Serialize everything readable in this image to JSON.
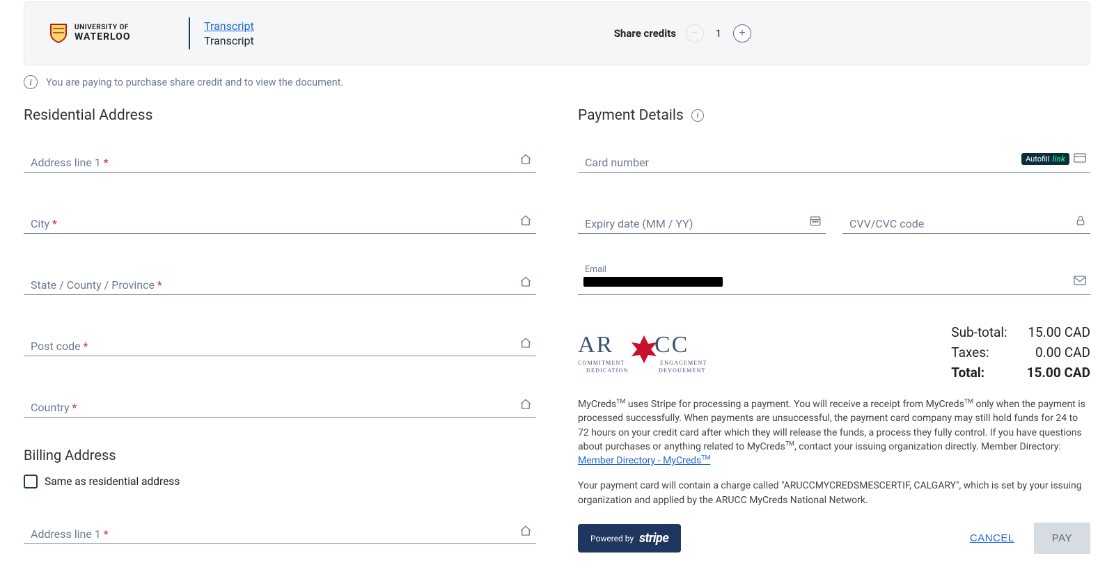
{
  "header": {
    "org": {
      "line1": "UNIVERSITY OF",
      "line2": "WATERLOO"
    },
    "doc_link": "Transcript",
    "doc_subtitle": "Transcript",
    "share_credits_label": "Share credits",
    "qty": "1"
  },
  "info_banner": "You are paying to purchase share credit and to view the document.",
  "residential": {
    "title": "Residential Address",
    "fields": {
      "address1": "Address line 1",
      "city": "City",
      "state": "State / County / Province",
      "postcode": "Post code",
      "country": "Country"
    }
  },
  "billing": {
    "title": "Billing Address",
    "same_as_label": "Same as residential address",
    "address1": "Address line 1"
  },
  "payment": {
    "title": "Payment Details",
    "card_number": "Card number",
    "expiry": "Expiry date (MM / YY)",
    "cvv": "CVV/CVC code",
    "email_label": "Email",
    "autofill": "Autofill",
    "autofill_brand": "link"
  },
  "totals": {
    "subtotal_label": "Sub-total:",
    "subtotal_value": "15.00 CAD",
    "taxes_label": "Taxes:",
    "taxes_value": "0.00 CAD",
    "total_label": "Total:",
    "total_value": "15.00 CAD"
  },
  "disclaimer": {
    "p1a": "MyCreds",
    "p1b": " uses Stripe for processing a payment. You will receive a receipt from MyCreds",
    "p1c": " only when the payment is processed successfully. When payments are unsuccessful, the payment card company may still hold funds for 24 to 72 hours on your credit card after which they will release the funds, a process they fully control. If you have questions about purchases or anything related to MyCreds",
    "p1d": ", contact your issuing organization directly. Member Directory: ",
    "link_text": "Member Directory - MyCreds",
    "p2": "Your payment card will contain a charge called \"ARUCCMYCREDSMESCERTIF, CALGARY\", which is set by your issuing organization and applied by the ARUCC MyCreds National Network."
  },
  "footer": {
    "powered_by": "Powered by",
    "stripe": "stripe",
    "cancel": "CANCEL",
    "pay": "PAY"
  }
}
